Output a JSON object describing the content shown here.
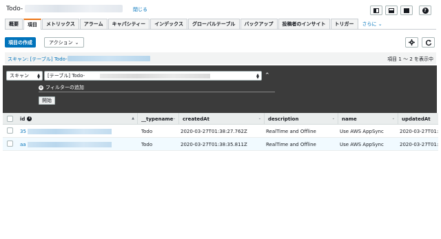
{
  "window": {
    "title": "Todo-",
    "close_label": "閉じる"
  },
  "tabs": [
    {
      "label": "概要"
    },
    {
      "label": "項目"
    },
    {
      "label": "メトリックス"
    },
    {
      "label": "アラーム"
    },
    {
      "label": "キャパシティー"
    },
    {
      "label": "インデックス"
    },
    {
      "label": "グローバルテーブル"
    },
    {
      "label": "バックアップ"
    },
    {
      "label": "投稿者のインサイト"
    },
    {
      "label": "トリガー"
    }
  ],
  "tabs_more": "さらに ⌄",
  "toolbar": {
    "create_label": "項目の作成",
    "action_label": "アクション",
    "action_caret": "⌄"
  },
  "scan_bar": {
    "label": "スキャン: [テーブル] Todo-",
    "items_count": "項目 1 ～ 2 を表示中"
  },
  "filter": {
    "mode_value": "スキャン",
    "table_value": "[テーブル] Todo-",
    "add_filter_label": "フィルターの追加",
    "start_label": "開始"
  },
  "table": {
    "headers": [
      "id",
      "__typename",
      "createdAt",
      "description",
      "name",
      "updatedAt"
    ],
    "rows": [
      {
        "id": "35",
        "typename": "Todo",
        "createdAt": "2020-03-27T01:38:27.762Z",
        "description": "RealTime and Offline",
        "name": "Use AWS AppSync",
        "updatedAt": "2020-03-27T01:3"
      },
      {
        "id": "aa",
        "typename": "Todo",
        "createdAt": "2020-03-27T01:38:35.811Z",
        "description": "RealTime and Offline",
        "name": "Use AWS AppSync",
        "updatedAt": "2020-03-27T01:3"
      }
    ]
  },
  "colors": {
    "accent": "#0073bb",
    "active_tab": "#ec7211",
    "filter_panel": "#3b3b3b"
  }
}
